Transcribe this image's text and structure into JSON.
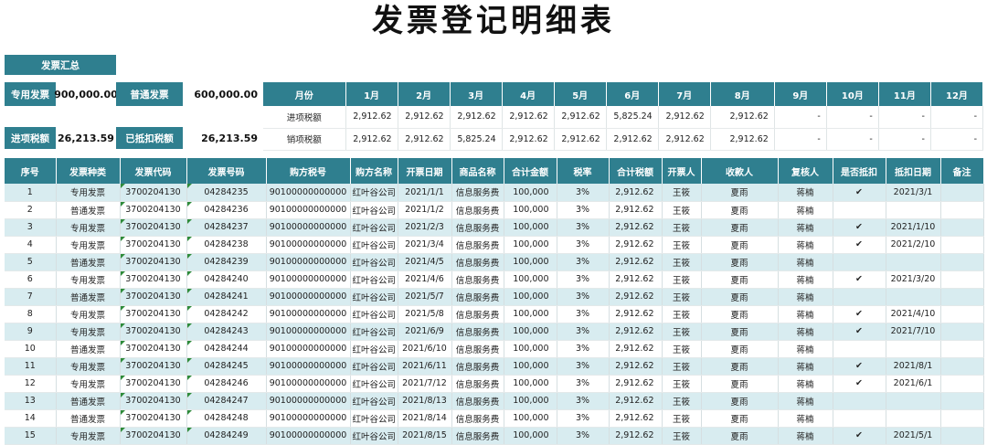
{
  "title": "发票登记明细表",
  "summary": {
    "header": "发票汇总",
    "special_label": "专用发票",
    "special_value": "900,000.00",
    "normal_label": "普通发票",
    "normal_value": "600,000.00",
    "input_tax_label": "进项税额",
    "input_tax_value": "26,213.59",
    "deducted_label": "已抵扣税额",
    "deducted_value": "26,213.59"
  },
  "monthly": {
    "header": "月份",
    "months": [
      "1月",
      "2月",
      "3月",
      "4月",
      "5月",
      "6月",
      "7月",
      "8月",
      "9月",
      "10月",
      "11月",
      "12月"
    ],
    "rows": [
      {
        "label": "进项税额",
        "values": [
          "2,912.62",
          "2,912.62",
          "2,912.62",
          "2,912.62",
          "2,912.62",
          "5,825.24",
          "2,912.62",
          "2,912.62",
          "-",
          "-",
          "-",
          "-"
        ]
      },
      {
        "label": "销项税额",
        "values": [
          "2,912.62",
          "2,912.62",
          "5,825.24",
          "2,912.62",
          "2,912.62",
          "2,912.62",
          "2,912.62",
          "2,912.62",
          "-",
          "-",
          "-",
          "-"
        ]
      }
    ]
  },
  "table": {
    "columns": [
      "序号",
      "发票种类",
      "发票代码",
      "发票号码",
      "购方税号",
      "购方名称",
      "开票日期",
      "商品名称",
      "合计金额",
      "税率",
      "合计税额",
      "开票人",
      "收款人",
      "复核人",
      "是否抵扣",
      "抵扣日期",
      "备注"
    ],
    "rows": [
      [
        "1",
        "专用发票",
        "3700204130",
        "04284235",
        "90100000000000",
        "红叶谷公司",
        "2021/1/1",
        "信息服务费",
        "100,000",
        "3%",
        "2,912.62",
        "王筱",
        "夏雨",
        "蒋楠",
        "✔",
        "2021/3/1",
        ""
      ],
      [
        "2",
        "普通发票",
        "3700204130",
        "04284236",
        "90100000000000",
        "红叶谷公司",
        "2021/1/2",
        "信息服务费",
        "100,000",
        "3%",
        "2,912.62",
        "王筱",
        "夏雨",
        "蒋楠",
        "",
        "",
        ""
      ],
      [
        "3",
        "专用发票",
        "3700204130",
        "04284237",
        "90100000000000",
        "红叶谷公司",
        "2021/2/3",
        "信息服务费",
        "100,000",
        "3%",
        "2,912.62",
        "王筱",
        "夏雨",
        "蒋楠",
        "✔",
        "2021/1/10",
        ""
      ],
      [
        "4",
        "专用发票",
        "3700204130",
        "04284238",
        "90100000000000",
        "红叶谷公司",
        "2021/3/4",
        "信息服务费",
        "100,000",
        "3%",
        "2,912.62",
        "王筱",
        "夏雨",
        "蒋楠",
        "✔",
        "2021/2/10",
        ""
      ],
      [
        "5",
        "普通发票",
        "3700204130",
        "04284239",
        "90100000000000",
        "红叶谷公司",
        "2021/4/5",
        "信息服务费",
        "100,000",
        "3%",
        "2,912.62",
        "王筱",
        "夏雨",
        "蒋楠",
        "",
        "",
        ""
      ],
      [
        "6",
        "专用发票",
        "3700204130",
        "04284240",
        "90100000000000",
        "红叶谷公司",
        "2021/4/6",
        "信息服务费",
        "100,000",
        "3%",
        "2,912.62",
        "王筱",
        "夏雨",
        "蒋楠",
        "✔",
        "2021/3/20",
        ""
      ],
      [
        "7",
        "普通发票",
        "3700204130",
        "04284241",
        "90100000000000",
        "红叶谷公司",
        "2021/5/7",
        "信息服务费",
        "100,000",
        "3%",
        "2,912.62",
        "王筱",
        "夏雨",
        "蒋楠",
        "",
        "",
        ""
      ],
      [
        "8",
        "专用发票",
        "3700204130",
        "04284242",
        "90100000000000",
        "红叶谷公司",
        "2021/5/8",
        "信息服务费",
        "100,000",
        "3%",
        "2,912.62",
        "王筱",
        "夏雨",
        "蒋楠",
        "✔",
        "2021/4/10",
        ""
      ],
      [
        "9",
        "专用发票",
        "3700204130",
        "04284243",
        "90100000000000",
        "红叶谷公司",
        "2021/6/9",
        "信息服务费",
        "100,000",
        "3%",
        "2,912.62",
        "王筱",
        "夏雨",
        "蒋楠",
        "✔",
        "2021/7/10",
        ""
      ],
      [
        "10",
        "普通发票",
        "3700204130",
        "04284244",
        "90100000000000",
        "红叶谷公司",
        "2021/6/10",
        "信息服务费",
        "100,000",
        "3%",
        "2,912.62",
        "王筱",
        "夏雨",
        "蒋楠",
        "",
        "",
        ""
      ],
      [
        "11",
        "专用发票",
        "3700204130",
        "04284245",
        "90100000000000",
        "红叶谷公司",
        "2021/6/11",
        "信息服务费",
        "100,000",
        "3%",
        "2,912.62",
        "王筱",
        "夏雨",
        "蒋楠",
        "✔",
        "2021/8/1",
        ""
      ],
      [
        "12",
        "专用发票",
        "3700204130",
        "04284246",
        "90100000000000",
        "红叶谷公司",
        "2021/7/12",
        "信息服务费",
        "100,000",
        "3%",
        "2,912.62",
        "王筱",
        "夏雨",
        "蒋楠",
        "✔",
        "2021/6/1",
        ""
      ],
      [
        "13",
        "普通发票",
        "3700204130",
        "04284247",
        "90100000000000",
        "红叶谷公司",
        "2021/8/13",
        "信息服务费",
        "100,000",
        "3%",
        "2,912.62",
        "王筱",
        "夏雨",
        "蒋楠",
        "",
        "",
        ""
      ],
      [
        "14",
        "普通发票",
        "3700204130",
        "04284248",
        "90100000000000",
        "红叶谷公司",
        "2021/8/14",
        "信息服务费",
        "100,000",
        "3%",
        "2,912.62",
        "王筱",
        "夏雨",
        "蒋楠",
        "",
        "",
        ""
      ],
      [
        "15",
        "专用发票",
        "3700204130",
        "04284249",
        "90100000000000",
        "红叶谷公司",
        "2021/8/15",
        "信息服务费",
        "100,000",
        "3%",
        "2,912.62",
        "王筱",
        "夏雨",
        "蒋楠",
        "✔",
        "2021/5/1",
        ""
      ]
    ]
  },
  "colors": {
    "accent": "#2f7f8f",
    "band": "#d8ecf0"
  }
}
